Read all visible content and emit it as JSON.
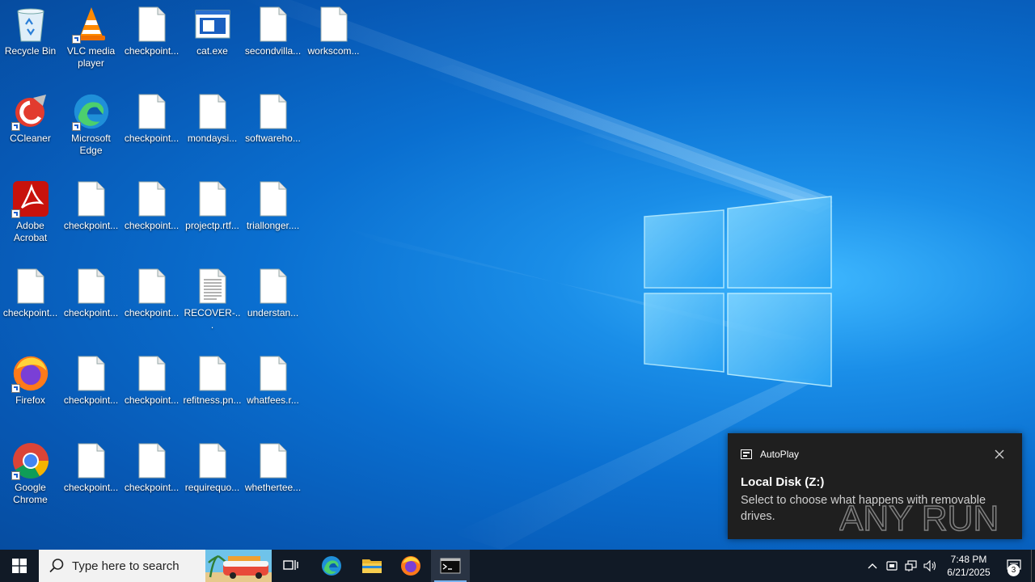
{
  "desktop": {
    "icons": [
      {
        "label": "Recycle Bin",
        "kind": "recycle-bin"
      },
      {
        "label": "VLC media player",
        "kind": "vlc"
      },
      {
        "label": "checkpoint...",
        "kind": "file"
      },
      {
        "label": "cat.exe",
        "kind": "exe"
      },
      {
        "label": "secondvilla...",
        "kind": "file"
      },
      {
        "label": "workscom...",
        "kind": "file"
      },
      {
        "label": "CCleaner",
        "kind": "ccleaner"
      },
      {
        "label": "Microsoft Edge",
        "kind": "edge"
      },
      {
        "label": "checkpoint...",
        "kind": "file"
      },
      {
        "label": "mondaysi...",
        "kind": "file"
      },
      {
        "label": "softwareho...",
        "kind": "file"
      },
      {
        "label": "Adobe Acrobat",
        "kind": "acrobat"
      },
      {
        "label": "checkpoint...",
        "kind": "file"
      },
      {
        "label": "checkpoint...",
        "kind": "file"
      },
      {
        "label": "projectp.rtf...",
        "kind": "file"
      },
      {
        "label": "triallonger....",
        "kind": "file"
      },
      {
        "label": "checkpoint...",
        "kind": "file"
      },
      {
        "label": "checkpoint...",
        "kind": "file"
      },
      {
        "label": "checkpoint...",
        "kind": "file"
      },
      {
        "label": "RECOVER-...",
        "kind": "textfile"
      },
      {
        "label": "understan...",
        "kind": "file"
      },
      {
        "label": "Firefox",
        "kind": "firefox"
      },
      {
        "label": "checkpoint...",
        "kind": "file"
      },
      {
        "label": "checkpoint...",
        "kind": "file"
      },
      {
        "label": "refitness.pn...",
        "kind": "file"
      },
      {
        "label": "whatfees.r...",
        "kind": "file"
      },
      {
        "label": "Google Chrome",
        "kind": "chrome"
      },
      {
        "label": "checkpoint...",
        "kind": "file"
      },
      {
        "label": "checkpoint...",
        "kind": "file"
      },
      {
        "label": "requirequo...",
        "kind": "file"
      },
      {
        "label": "whethertee...",
        "kind": "file"
      }
    ]
  },
  "toast": {
    "app": "AutoPlay",
    "title": "Local Disk (Z:)",
    "body": "Select to choose what happens with removable drives."
  },
  "watermark": "ANY RUN",
  "taskbar": {
    "search_placeholder": "Type here to search",
    "apps": [
      "task-view",
      "edge",
      "file-explorer",
      "firefox",
      "terminal"
    ],
    "time": "7:48 PM",
    "date": "6/21/2025",
    "notification_count": "3"
  },
  "colors": {
    "desktop_blue": "#0a6fd0",
    "taskbar": "#111a26",
    "toast_bg": "#1f1f1f"
  }
}
